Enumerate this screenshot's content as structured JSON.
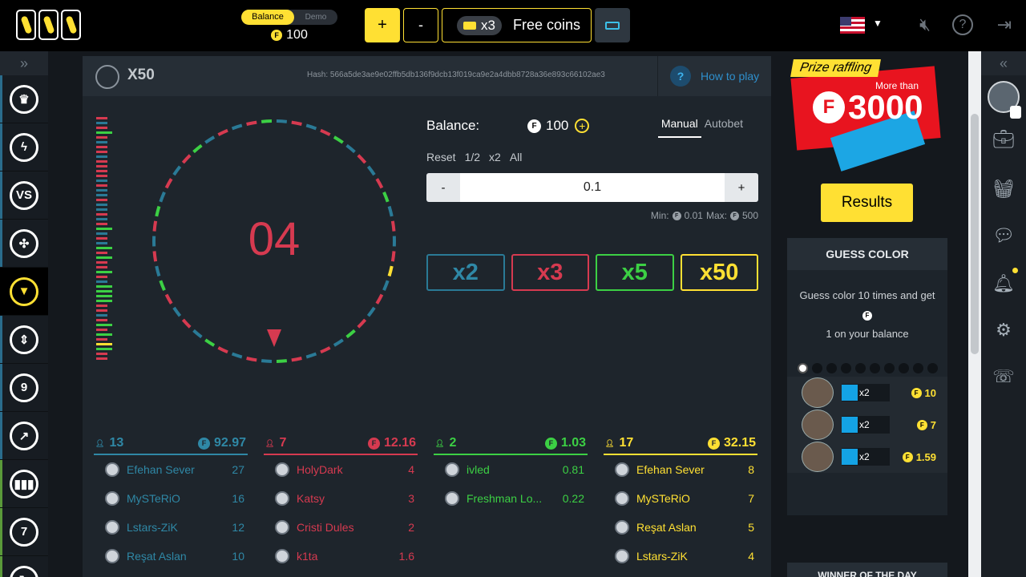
{
  "topbar": {
    "balance_label": "Balance",
    "demo_label": "Demo",
    "balance_value": "100",
    "plus_label": "+",
    "minus_label": "-",
    "free_multiplier": "x3",
    "free_coins_label": "Free coins",
    "coin_symbol": "F"
  },
  "game": {
    "title": "X50",
    "hash": "Hash: 566a5de3ae9e02ffb5db136f9dcb13f019ca9e2a4dbb8728a36e893c66102ae3",
    "how_to_play": "How to play",
    "help_symbol": "?",
    "wheel_number": "04",
    "history_colors": [
      "#d63a50",
      "#2a7a96",
      "#d63a50",
      "#3cd044",
      "#d63a50",
      "#2a7a96",
      "#d63a50",
      "#d63a50",
      "#2a7a96",
      "#d63a50",
      "#d63a50",
      "#d63a50",
      "#d63a50",
      "#2a7a96",
      "#d63a50",
      "#2a7a96",
      "#2a7a96",
      "#d63a50",
      "#2a7a96",
      "#2a7a96",
      "#d63a50",
      "#2a7a96",
      "#d63a50",
      "#3cd044",
      "#2a7a96",
      "#d63a50",
      "#2a7a96",
      "#3cd044",
      "#d63a50",
      "#3cd044",
      "#d63a50",
      "#d63a50",
      "#3cd044",
      "#d63a50",
      "#2a7a96",
      "#3cd044",
      "#3cd044",
      "#3cd044",
      "#3cd044",
      "#d63a50",
      "#d63a50",
      "#2a7a96",
      "#d63a50",
      "#3cd044",
      "#d63a50",
      "#3cd044",
      "#d63a50",
      "#ffe033",
      "#3cd044",
      "#d63a50",
      "#d63a50"
    ]
  },
  "bet": {
    "balance_label": "Balance:",
    "balance_value": "100",
    "add_symbol": "+",
    "mode_manual": "Manual",
    "mode_autobet": "Autobet",
    "quick": [
      "Reset",
      "1/2",
      "x2",
      "All"
    ],
    "decrement": "-",
    "increment": "+",
    "amount": "0.1",
    "min_label": "Min:",
    "min_value": "0.01",
    "max_label": "Max:",
    "max_value": "500",
    "multipliers": [
      {
        "label": "x2",
        "color": "#2a7a96",
        "text_color": "#2f88a6"
      },
      {
        "label": "x3",
        "color": "#d63a50",
        "text_color": "#d63a50"
      },
      {
        "label": "x5",
        "color": "#3cd044",
        "text_color": "#3cd044"
      },
      {
        "label": "x50",
        "color": "#ffe033",
        "text_color": "#ffe033"
      }
    ]
  },
  "columns": [
    {
      "count": "13",
      "total": "92.97",
      "color": "#2f88a6",
      "players": [
        {
          "name": "Efehan Sever",
          "amount": "27"
        },
        {
          "name": "MySTeRiO",
          "amount": "16"
        },
        {
          "name": "Lstars-ZiK",
          "amount": "12"
        },
        {
          "name": "Reşat Aslan",
          "amount": "10"
        }
      ]
    },
    {
      "count": "7",
      "total": "12.16",
      "color": "#d63a50",
      "players": [
        {
          "name": "HolyDark",
          "amount": "4"
        },
        {
          "name": "Katsy",
          "amount": "3"
        },
        {
          "name": "Cristi Dules",
          "amount": "2"
        },
        {
          "name": "k1ta",
          "amount": "1.6"
        }
      ]
    },
    {
      "count": "2",
      "total": "1.03",
      "color": "#3cd044",
      "players": [
        {
          "name": "ivled",
          "amount": "0.81"
        },
        {
          "name": "Freshman Lo...",
          "amount": "0.22"
        }
      ]
    },
    {
      "count": "17",
      "total": "32.15",
      "color": "#ffe033",
      "players": [
        {
          "name": "Efehan Sever",
          "amount": "8"
        },
        {
          "name": "MySTeRiO",
          "amount": "7"
        },
        {
          "name": "Reşat Aslan",
          "amount": "5"
        },
        {
          "name": "Lstars-ZiK",
          "amount": "4"
        }
      ]
    }
  ],
  "prize": {
    "tag": "Prize raffling",
    "more_than": "More than",
    "amount": "3000",
    "coin_symbol": "F",
    "results_label": "Results"
  },
  "guess": {
    "title": "GUESS COLOR",
    "text_1": "Guess color 10 times and get",
    "text_2": "1 on your balance",
    "rows": [
      {
        "mult": "x2",
        "win": "10"
      },
      {
        "mult": "x2",
        "win": "7"
      },
      {
        "mult": "x2",
        "win": "1.59"
      }
    ],
    "winner_title": "WINNER OF THE DAY"
  }
}
